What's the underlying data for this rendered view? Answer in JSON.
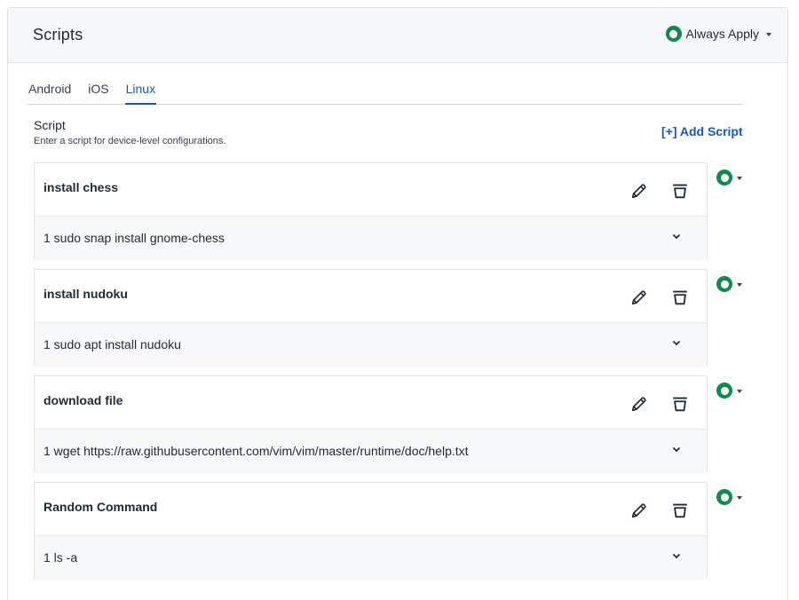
{
  "header": {
    "title": "Scripts",
    "apply_label": "Always Apply"
  },
  "tabs": [
    {
      "label": "Android",
      "active": false
    },
    {
      "label": "iOS",
      "active": false
    },
    {
      "label": "Linux",
      "active": true
    }
  ],
  "section": {
    "title": "Script",
    "subtitle": "Enter a script for device-level configurations.",
    "add_label": "[+] Add Script"
  },
  "scripts": [
    {
      "name": "install chess",
      "command": "1 sudo snap install gnome-chess"
    },
    {
      "name": "install nudoku",
      "command": "1 sudo apt install nudoku"
    },
    {
      "name": "download file",
      "command": "1 wget https://raw.githubusercontent.com/vim/vim/master/runtime/doc/help.txt"
    },
    {
      "name": "Random Command",
      "command": "1 ls -a"
    }
  ],
  "colors": {
    "accent": "#1958b7",
    "status_green": "#0e8a4f",
    "header_bg": "#f5f7fa",
    "body_bg": "#f6f8fa"
  },
  "icons": {
    "status": "ring-icon",
    "edit": "pencil-icon",
    "delete": "trash-icon",
    "expand": "chevron-down-icon",
    "dropdown": "caret-down-icon"
  }
}
